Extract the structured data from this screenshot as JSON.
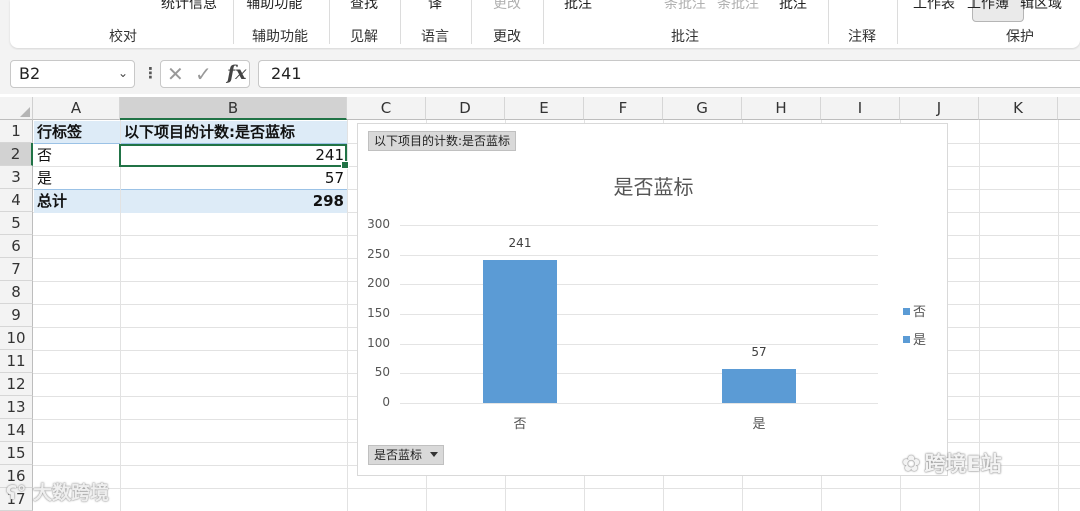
{
  "ribbon": {
    "top_labels": [
      {
        "text": "统计信息",
        "dim": false
      },
      {
        "text": "辅助功能 ˅",
        "dim": false
      },
      {
        "text": "查找",
        "dim": false
      },
      {
        "text": "译",
        "dim": false
      },
      {
        "text": "更改",
        "dim": true
      },
      {
        "text": "批注",
        "dim": false
      },
      {
        "text": "条批注",
        "dim": true
      },
      {
        "text": "条批注",
        "dim": true
      },
      {
        "text": "批注",
        "dim": false
      },
      {
        "text": "˅",
        "dim": false
      },
      {
        "text": "工作表",
        "dim": false
      },
      {
        "text": "工作簿",
        "dim": false
      },
      {
        "text": "辑区域",
        "dim": false
      }
    ],
    "groups": [
      "校对",
      "辅助功能",
      "见解",
      "语言",
      "更改",
      "批注",
      "注释",
      "保护"
    ]
  },
  "formula_bar": {
    "name_box": "B2",
    "formula": "241",
    "fx_label": "fx"
  },
  "columns": [
    "A",
    "B",
    "C",
    "D",
    "E",
    "F",
    "G",
    "H",
    "I",
    "J",
    "K"
  ],
  "rows": [
    "1",
    "2",
    "3",
    "4",
    "5",
    "6",
    "7",
    "8",
    "9",
    "10",
    "11",
    "12",
    "13",
    "14",
    "15",
    "16",
    "17"
  ],
  "pivot": {
    "header_label": "行标签",
    "header_value": "以下项目的计数:是否蓝标",
    "rows": [
      {
        "label": "否",
        "value": "241"
      },
      {
        "label": "是",
        "value": "57"
      }
    ],
    "total_label": "总计",
    "total_value": "298"
  },
  "chart_data": {
    "type": "bar",
    "title": "是否蓝标",
    "value_field_button": "以下项目的计数:是否蓝标",
    "axis_field_button": "是否蓝标",
    "categories": [
      "否",
      "是"
    ],
    "values": [
      241,
      57
    ],
    "legend": [
      "否",
      "是"
    ],
    "legend_position": "right",
    "yticks": [
      0,
      50,
      100,
      150,
      200,
      250,
      300
    ],
    "ylim": [
      0,
      300
    ],
    "grid": true,
    "bar_color": "#5b9bd5",
    "xlabel": "",
    "ylabel": ""
  },
  "watermarks": {
    "left": "大数跨境",
    "right": "跨境E站"
  },
  "colors": {
    "accent": "#217346",
    "pivot_fill": "#ddebf7",
    "bar": "#5b9bd5"
  }
}
